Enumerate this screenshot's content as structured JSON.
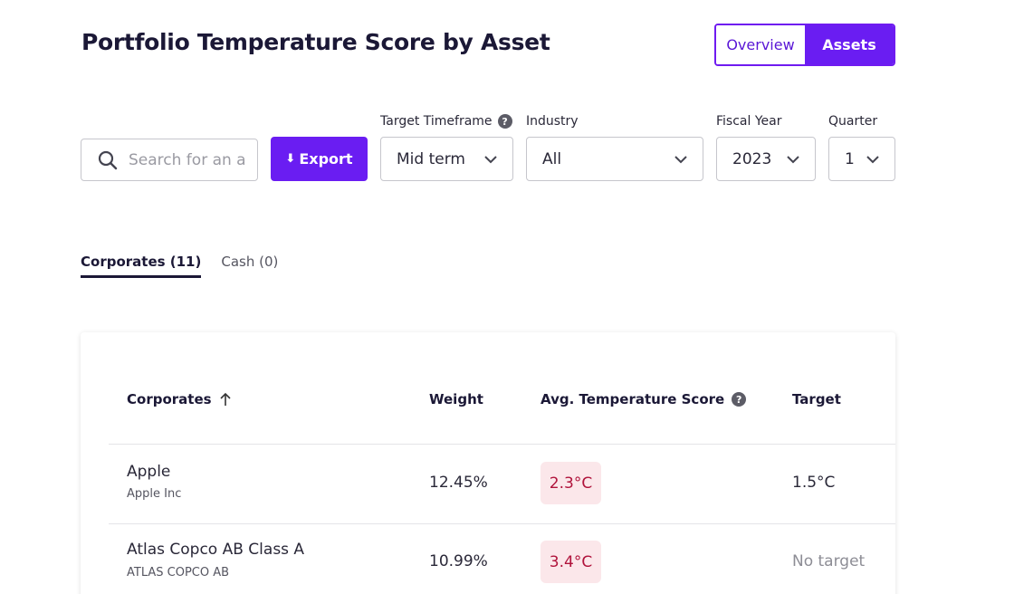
{
  "page": {
    "title": "Portfolio Temperature Score by Asset"
  },
  "view_toggle": {
    "overview": "Overview",
    "assets": "Assets"
  },
  "filters": {
    "search_placeholder": "Search for an asset",
    "export_label": "Export",
    "export_icon": "download-icon",
    "timeframe": {
      "label": "Target Timeframe",
      "value": "Mid term"
    },
    "industry": {
      "label": "Industry",
      "value": "All"
    },
    "fiscal_year": {
      "label": "Fiscal Year",
      "value": "2023"
    },
    "quarter": {
      "label": "Quarter",
      "value": "1"
    }
  },
  "tabs": [
    {
      "label": "Corporates (11)",
      "active": true
    },
    {
      "label": "Cash (0)",
      "active": false
    }
  ],
  "table": {
    "headers": {
      "corporates": "Corporates",
      "weight": "Weight",
      "avg_temp": "Avg. Temperature Score",
      "target": "Target"
    },
    "rows": [
      {
        "name": "Apple",
        "legal_name": "Apple Inc",
        "weight": "12.45%",
        "temp": "2.3°C",
        "target": "1.5°C"
      },
      {
        "name": "Atlas Copco AB Class A",
        "legal_name": "ATLAS COPCO AB",
        "weight": "10.99%",
        "temp": "3.4°C",
        "target": "No target"
      }
    ]
  },
  "colors": {
    "accent": "#6a1df2",
    "heading": "#1b1836",
    "badge_bg": "#fbe7ea",
    "badge_text": "#b0133b"
  }
}
